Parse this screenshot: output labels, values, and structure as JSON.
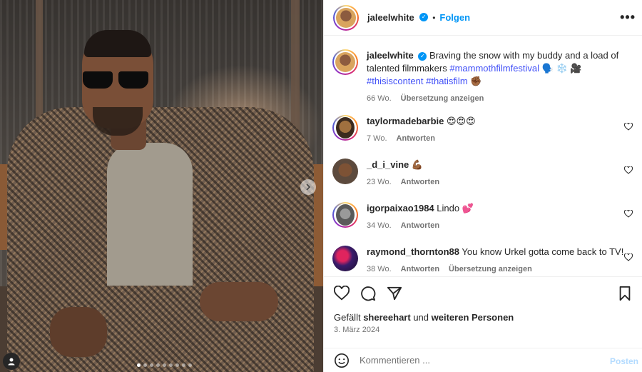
{
  "post": {
    "username": "jaleelwhite",
    "follow_label": "Folgen",
    "separator": "•",
    "more_icon": "more-options-icon",
    "caption": {
      "username": "jaleelwhite",
      "text": "Braving the snow with my buddy and a load of talented filmmakers",
      "hashtag1": "#mammothfilmfestival",
      "emojis1": "🗣️ ❄️ 🎥",
      "hashtag2": "#thisiscontent",
      "hashtag3": "#thatisfilm",
      "emojis2": "✊🏾",
      "age": "66 Wo.",
      "translate_label": "Übersetzung anzeigen"
    },
    "comments": [
      {
        "username": "taylormadebarbie",
        "text": "😍😍😍",
        "age": "7 Wo.",
        "reply_label": "Antworten",
        "translate_label": ""
      },
      {
        "username": "_d_i_vine",
        "text": "💪🏾",
        "age": "23 Wo.",
        "reply_label": "Antworten",
        "translate_label": ""
      },
      {
        "username": "igorpaixao1984",
        "text": "Lindo 💕",
        "age": "34 Wo.",
        "reply_label": "Antworten",
        "translate_label": ""
      },
      {
        "username": "raymond_thornton88",
        "text": "You know Urkel gotta come back to TV!",
        "age": "38 Wo.",
        "reply_label": "Antworten",
        "translate_label": "Übersetzung anzeigen"
      }
    ],
    "likes": {
      "prefix": "Gefällt",
      "user": "shereehart",
      "middle": "und",
      "suffix": "weiteren Personen"
    },
    "date": "3. März 2024",
    "comment_placeholder": "Kommentieren ...",
    "post_label": "Posten"
  },
  "carousel": {
    "total_slides": 9,
    "active_index": 0,
    "next_icon": "chevron-right-icon"
  },
  "colors": {
    "accent": "#0095f6",
    "hashtag": "#4150f7",
    "muted": "#737373"
  }
}
